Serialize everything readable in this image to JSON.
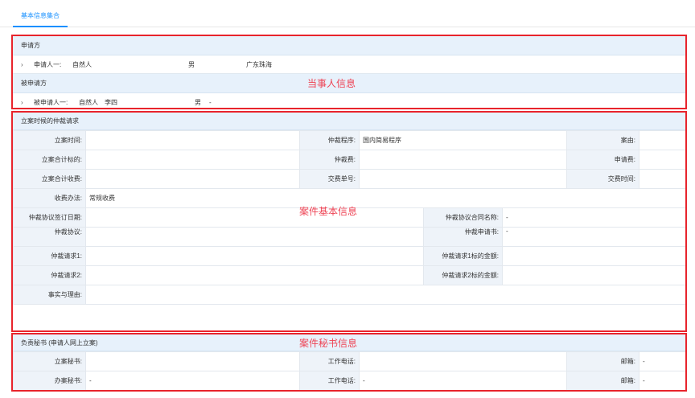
{
  "tabs": {
    "active": "基本信息集合"
  },
  "party_section": {
    "applicant_header": "申请方",
    "applicant_row": {
      "label": "申请人一:",
      "type": "自然人",
      "gender": "男",
      "location": "广东珠海"
    },
    "respondent_header": "被申请方",
    "respondent_row": {
      "label": "被申请人一:",
      "type": "自然人",
      "name": "李四",
      "gender": "男",
      "extra": "-"
    },
    "annotation": "当事人信息"
  },
  "case_section": {
    "header": "立案时候的仲裁请求",
    "annotation": "案件基本信息",
    "filing_time_label": "立案时间:",
    "arb_procedure_label": "仲裁程序:",
    "arb_procedure_value": "国内简易程序",
    "cause_label": "案由:",
    "subject_amount_label": "立案合计标的:",
    "arb_fee_label": "仲裁费:",
    "application_fee_label": "申请费:",
    "total_fee_label": "立案合计收费:",
    "payment_no_label": "交费单号:",
    "payment_time_label": "交费时间:",
    "fee_method_label": "收费办法:",
    "fee_method_value": "常规收费",
    "agreement_date_label": "仲裁协议签订日期:",
    "agreement_contract_label": "仲裁协议合同名称:",
    "agreement_contract_value": "-",
    "agreement_label": "仲裁协议:",
    "application_doc_label": "仲裁申请书:",
    "application_doc_value": "-",
    "request1_label": "仲裁请求1:",
    "request1_amount_label": "仲裁请求1标的金额:",
    "request2_label": "仲裁请求2:",
    "request2_amount_label": "仲裁请求2标的金额:",
    "facts_label": "事实与理由:"
  },
  "secretary_section": {
    "header": "负责秘书 (申请人网上立案)",
    "annotation": "案件秘书信息",
    "filing_secretary_label": "立案秘书:",
    "work_phone_label": "工作电话:",
    "email_label": "邮箱:",
    "email_value": "-",
    "handling_secretary_label": "办案秘书:",
    "handling_secretary_value": "-",
    "work_phone2_label": "工作电话:",
    "work_phone2_value": "-",
    "email2_label": "邮箱:",
    "email2_value": "-"
  }
}
